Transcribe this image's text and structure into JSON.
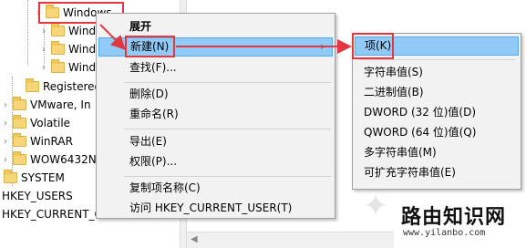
{
  "tree": {
    "nodes": [
      {
        "label": "Windows"
      },
      {
        "label": "Windo"
      },
      {
        "label": "Windo"
      },
      {
        "label": "Windo"
      },
      {
        "label": "RegisteredA"
      },
      {
        "label": "VMware, In"
      },
      {
        "label": "Volatile"
      },
      {
        "label": "WinRAR"
      },
      {
        "label": "WOW6432N"
      },
      {
        "label": "SYSTEM"
      },
      {
        "label": "HKEY_USERS"
      },
      {
        "label": "HKEY_CURRENT_C"
      }
    ]
  },
  "context_menu": {
    "items": [
      {
        "label": "展开"
      },
      {
        "label": "新建(N)"
      },
      {
        "label": "查找(F)..."
      },
      {
        "label": "删除(D)"
      },
      {
        "label": "重命名(R)"
      },
      {
        "label": "导出(E)"
      },
      {
        "label": "权限(P)..."
      },
      {
        "label": "复制项名称(C)"
      },
      {
        "label": "访问 HKEY_CURRENT_USER(T)"
      }
    ],
    "submenu_arrow": "›"
  },
  "submenu": {
    "items": [
      {
        "label": "项(K)"
      },
      {
        "label": "字符串值(S)"
      },
      {
        "label": "二进制值(B)"
      },
      {
        "label": "DWORD (32 位)值(D)"
      },
      {
        "label": "QWORD (64 位)值(Q)"
      },
      {
        "label": "多字符串值(M)"
      },
      {
        "label": "可扩充字符串值(E)"
      }
    ]
  },
  "watermark": {
    "title": "路由知识网",
    "url": "www.yilanbo.com"
  },
  "colors": {
    "highlight": "#91c9f7",
    "annotation_red": "#e2373f",
    "menu_bg": "#f2f2f2",
    "folder": "#f7d67a"
  }
}
